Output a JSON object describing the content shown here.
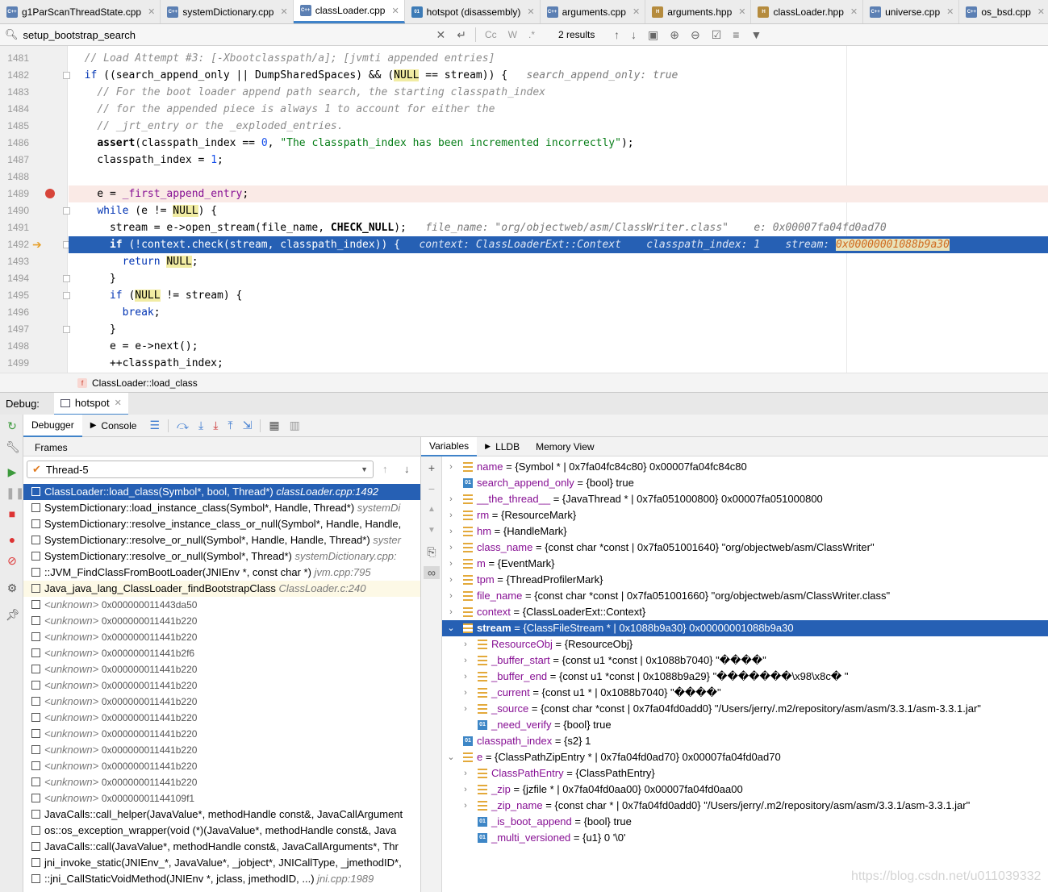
{
  "tabs": [
    {
      "label": "g1ParScanThreadState.cpp",
      "type": "cpp",
      "active": false
    },
    {
      "label": "systemDictionary.cpp",
      "type": "cpp",
      "active": false
    },
    {
      "label": "classLoader.cpp",
      "type": "cpp",
      "active": true
    },
    {
      "label": "hotspot (disassembly)",
      "type": "bin",
      "active": false
    },
    {
      "label": "arguments.cpp",
      "type": "cpp",
      "active": false
    },
    {
      "label": "arguments.hpp",
      "type": "h",
      "active": false
    },
    {
      "label": "classLoader.hpp",
      "type": "h",
      "active": false
    },
    {
      "label": "universe.cpp",
      "type": "cpp",
      "active": false
    },
    {
      "label": "os_bsd.cpp",
      "type": "cpp",
      "active": false
    }
  ],
  "search": {
    "query": "setup_bootstrap_search",
    "results": "2 results",
    "cc": "Cc",
    "w": "W",
    "regex": ".*"
  },
  "editor": {
    "breadcrumb": "ClassLoader::load_class",
    "lines": [
      {
        "num": "1481",
        "code": "// Load Attempt #3: [-Xbootclasspath/a]; [jvmti appended entries]"
      },
      {
        "num": "1482",
        "code": "if ((search_append_only || DumpSharedSpaces) && (NULL == stream)) {",
        "hint": "search_append_only: true"
      },
      {
        "num": "1483",
        "code": "// For the boot loader append path search, the starting classpath_index"
      },
      {
        "num": "1484",
        "code": "// for the appended piece is always 1 to account for either the"
      },
      {
        "num": "1485",
        "code": "// _jrt_entry or the _exploded_entries."
      },
      {
        "num": "1486",
        "code": "assert(classpath_index == 0, \"The classpath_index has been incremented incorrectly\");"
      },
      {
        "num": "1487",
        "code": "classpath_index = 1;"
      },
      {
        "num": "1488",
        "code": ""
      },
      {
        "num": "1489",
        "code": "e = _first_append_entry;"
      },
      {
        "num": "1490",
        "code": "while (e != NULL) {"
      },
      {
        "num": "1491",
        "code": "stream = e->open_stream(file_name, CHECK_NULL);",
        "hint": "file_name: \"org/objectweb/asm/ClassWriter.class\"    e: 0x00007fa04fd0ad70"
      },
      {
        "num": "1492",
        "code": "if (!context.check(stream, classpath_index)) {",
        "hint": "context: ClassLoaderExt::Context    classpath_index: 1    stream: ",
        "hint_value": "0x00000001088b9a30"
      },
      {
        "num": "1493",
        "code": "return NULL;"
      },
      {
        "num": "1494",
        "code": "}"
      },
      {
        "num": "1495",
        "code": "if (NULL != stream) {"
      },
      {
        "num": "1496",
        "code": "break;"
      },
      {
        "num": "1497",
        "code": "}"
      },
      {
        "num": "1498",
        "code": "e = e->next();"
      },
      {
        "num": "1499",
        "code": "++classpath_index;"
      }
    ]
  },
  "debug": {
    "label": "Debug:",
    "session": "hotspot",
    "tabs": {
      "debugger": "Debugger",
      "console": "Console"
    },
    "frames_title": "Frames",
    "thread": "Thread-5",
    "frames": [
      {
        "fn": "ClassLoader::load_class(Symbol*, bool, Thread*)",
        "loc": "classLoader.cpp:1492"
      },
      {
        "fn": "SystemDictionary::load_instance_class(Symbol*, Handle, Thread*)",
        "loc": "systemDi"
      },
      {
        "fn": "SystemDictionary::resolve_instance_class_or_null(Symbol*, Handle, Handle,",
        "loc": ""
      },
      {
        "fn": "SystemDictionary::resolve_or_null(Symbol*, Handle, Handle, Thread*)",
        "loc": "syster"
      },
      {
        "fn": "SystemDictionary::resolve_or_null(Symbol*, Thread*)",
        "loc": "systemDictionary.cpp:"
      },
      {
        "fn": "::JVM_FindClassFromBootLoader(JNIEnv *, const char *)",
        "loc": "jvm.cpp:795"
      },
      {
        "fn": "Java_java_lang_ClassLoader_findBootstrapClass",
        "loc": "ClassLoader.c:240"
      },
      {
        "fn": "<unknown>",
        "addr": "0x000000011443da50"
      },
      {
        "fn": "<unknown>",
        "addr": "0x000000011441b220"
      },
      {
        "fn": "<unknown>",
        "addr": "0x000000011441b220"
      },
      {
        "fn": "<unknown>",
        "addr": "0x000000011441b2f6"
      },
      {
        "fn": "<unknown>",
        "addr": "0x000000011441b220"
      },
      {
        "fn": "<unknown>",
        "addr": "0x000000011441b220"
      },
      {
        "fn": "<unknown>",
        "addr": "0x000000011441b220"
      },
      {
        "fn": "<unknown>",
        "addr": "0x000000011441b220"
      },
      {
        "fn": "<unknown>",
        "addr": "0x000000011441b220"
      },
      {
        "fn": "<unknown>",
        "addr": "0x000000011441b220"
      },
      {
        "fn": "<unknown>",
        "addr": "0x000000011441b220"
      },
      {
        "fn": "<unknown>",
        "addr": "0x000000011441b220"
      },
      {
        "fn": "<unknown>",
        "addr": "0x00000001144109f1"
      },
      {
        "fn": "JavaCalls::call_helper(JavaValue*, methodHandle const&, JavaCallArgument",
        "loc": ""
      },
      {
        "fn": "os::os_exception_wrapper(void (*)(JavaValue*, methodHandle const&, Java",
        "loc": ""
      },
      {
        "fn": "JavaCalls::call(JavaValue*, methodHandle const&, JavaCallArguments*, Thr",
        "loc": ""
      },
      {
        "fn": "jni_invoke_static(JNIEnv_*, JavaValue*, _jobject*, JNICallType, _jmethodID*,",
        "loc": ""
      },
      {
        "fn": "::jni_CallStaticVoidMethod(JNIEnv *, jclass, jmethodID, ...)",
        "loc": "jni.cpp:1989"
      }
    ],
    "vars_tabs": {
      "variables": "Variables",
      "lldb": "LLDB",
      "memory": "Memory View"
    },
    "variables": [
      {
        "name": "name",
        "value": " = {Symbol * | 0x7fa04fc84c80} 0x00007fa04fc84c80",
        "kind": "obj",
        "indent": 0,
        "exp": "closed"
      },
      {
        "name": "search_append_only",
        "value": " = {bool} true",
        "kind": "prim",
        "indent": 0,
        "exp": "none"
      },
      {
        "name": "__the_thread__",
        "value": " = {JavaThread * | 0x7fa051000800} 0x00007fa051000800",
        "kind": "obj",
        "indent": 0,
        "exp": "closed"
      },
      {
        "name": "rm",
        "value": " = {ResourceMark}",
        "kind": "obj",
        "indent": 0,
        "exp": "closed"
      },
      {
        "name": "hm",
        "value": " = {HandleMark}",
        "kind": "obj",
        "indent": 0,
        "exp": "closed"
      },
      {
        "name": "class_name",
        "value": " = {const char *const | 0x7fa051001640} \"org/objectweb/asm/ClassWriter\"",
        "kind": "obj",
        "indent": 0,
        "exp": "closed"
      },
      {
        "name": "m",
        "value": " = {EventMark}",
        "kind": "obj",
        "indent": 0,
        "exp": "closed"
      },
      {
        "name": "tpm",
        "value": " = {ThreadProfilerMark}",
        "kind": "obj",
        "indent": 0,
        "exp": "closed"
      },
      {
        "name": "file_name",
        "value": " = {const char *const | 0x7fa051001660} \"org/objectweb/asm/ClassWriter.class\"",
        "kind": "obj",
        "indent": 0,
        "exp": "closed"
      },
      {
        "name": "context",
        "value": " = {ClassLoaderExt::Context}",
        "kind": "obj",
        "indent": 0,
        "exp": "closed"
      },
      {
        "name": "stream",
        "value": " = {ClassFileStream * | 0x1088b9a30} 0x00000001088b9a30",
        "kind": "obj",
        "indent": 0,
        "exp": "open",
        "selected": true
      },
      {
        "name": "ResourceObj",
        "value": " = {ResourceObj}",
        "kind": "obj",
        "indent": 1,
        "exp": "closed"
      },
      {
        "name": "_buffer_start",
        "value": " = {const u1 *const | 0x1088b7040} \"����\"",
        "kind": "obj",
        "indent": 1,
        "exp": "closed"
      },
      {
        "name": "_buffer_end",
        "value": " = {const u1 *const | 0x1088b9a29} \"�������\\x98\\x8c�  \"",
        "kind": "obj",
        "indent": 1,
        "exp": "closed"
      },
      {
        "name": "_current",
        "value": " = {const u1 * | 0x1088b7040} \"����\"",
        "kind": "obj",
        "indent": 1,
        "exp": "closed"
      },
      {
        "name": "_source",
        "value": " = {const char *const | 0x7fa04fd0add0} \"/Users/jerry/.m2/repository/asm/asm/3.3.1/asm-3.3.1.jar\"",
        "kind": "obj",
        "indent": 1,
        "exp": "closed"
      },
      {
        "name": "_need_verify",
        "value": " = {bool} true",
        "kind": "prim",
        "indent": 1,
        "exp": "none"
      },
      {
        "name": "classpath_index",
        "value": " = {s2} 1",
        "kind": "prim",
        "indent": 0,
        "exp": "none"
      },
      {
        "name": "e",
        "value": " = {ClassPathZipEntry * | 0x7fa04fd0ad70} 0x00007fa04fd0ad70",
        "kind": "obj",
        "indent": 0,
        "exp": "open"
      },
      {
        "name": "ClassPathEntry",
        "value": " = {ClassPathEntry}",
        "kind": "obj",
        "indent": 1,
        "exp": "closed"
      },
      {
        "name": "_zip",
        "value": " = {jzfile * | 0x7fa04fd0aa00} 0x00007fa04fd0aa00",
        "kind": "obj",
        "indent": 1,
        "exp": "closed"
      },
      {
        "name": "_zip_name",
        "value": " = {const char * | 0x7fa04fd0add0} \"/Users/jerry/.m2/repository/asm/asm/3.3.1/asm-3.3.1.jar\"",
        "kind": "obj",
        "indent": 1,
        "exp": "closed"
      },
      {
        "name": "_is_boot_append",
        "value": " = {bool} true",
        "kind": "prim",
        "indent": 1,
        "exp": "none"
      },
      {
        "name": "_multi_versioned",
        "value": " = {u1} 0 '\\0'",
        "kind": "prim",
        "indent": 1,
        "exp": "none"
      }
    ]
  },
  "watermark": "https://blog.csdn.net/u011039332"
}
